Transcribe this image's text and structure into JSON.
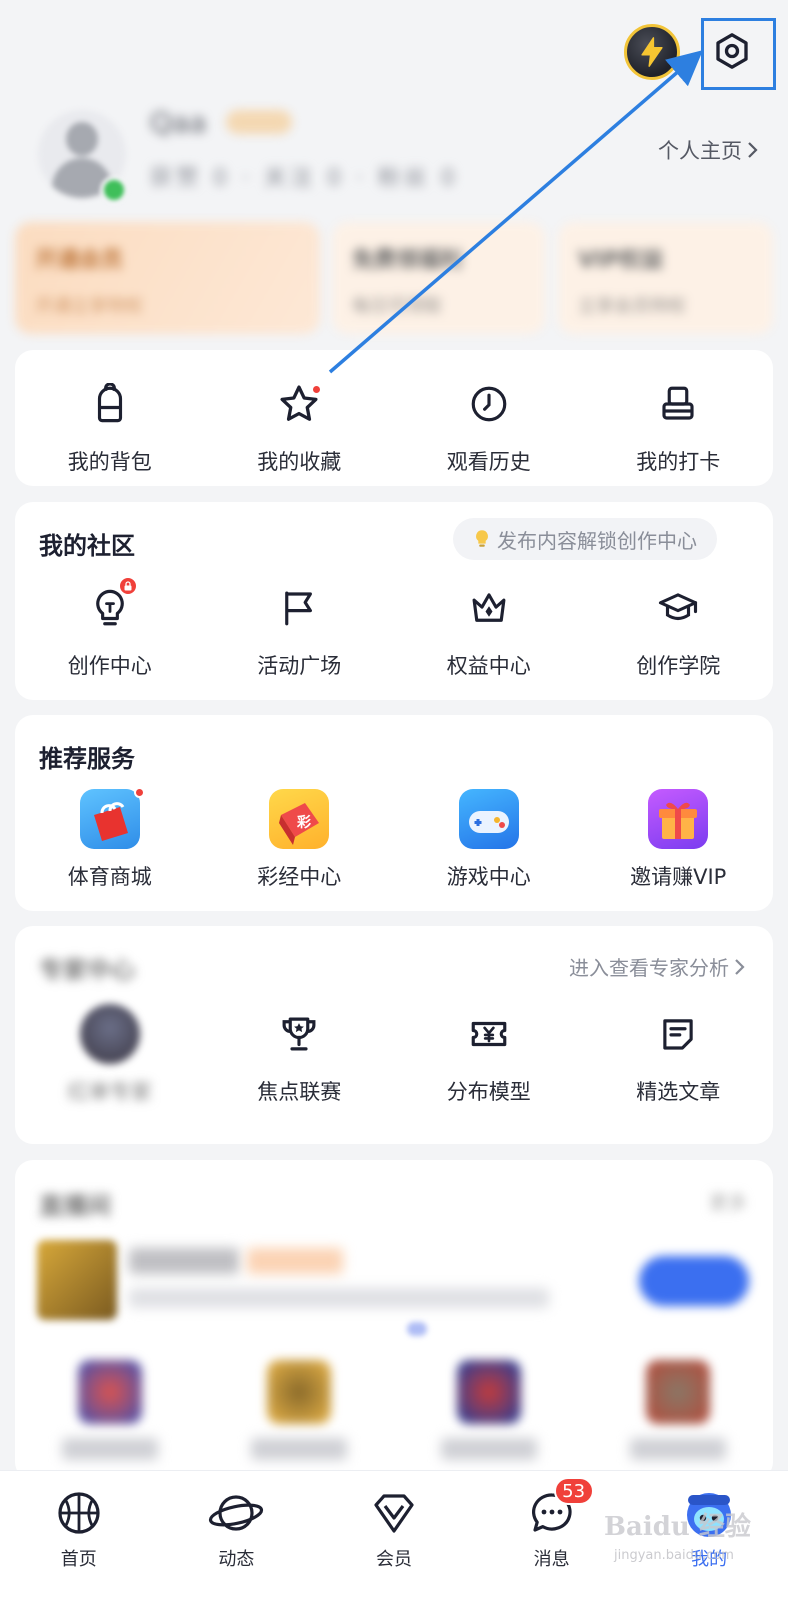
{
  "header": {
    "profile_link": "个人主页",
    "user_name_blurred": "Qaa",
    "user_stats_blurred": "获赞 0 · 关注 0 · 粉丝 0"
  },
  "promos": [
    {
      "title": "开通会员",
      "sub": "开通立享特权"
    },
    {
      "title": "免费领福利",
      "sub": "每日可领取"
    },
    {
      "title": "VIP权益",
      "sub": "立享会员特权"
    }
  ],
  "quick": {
    "items": [
      {
        "label": "我的背包",
        "icon": "backpack-icon"
      },
      {
        "label": "我的收藏",
        "icon": "star-icon"
      },
      {
        "label": "观看历史",
        "icon": "clock-icon"
      },
      {
        "label": "我的打卡",
        "icon": "checkin-icon"
      }
    ]
  },
  "community": {
    "title": "我的社区",
    "hint": "发布内容解锁创作中心",
    "items": [
      {
        "label": "创作中心",
        "icon": "lightbulb-icon"
      },
      {
        "label": "活动广场",
        "icon": "flag-icon"
      },
      {
        "label": "权益中心",
        "icon": "crown-icon"
      },
      {
        "label": "创作学院",
        "icon": "graduation-cap-icon"
      }
    ]
  },
  "services": {
    "title": "推荐服务",
    "items": [
      {
        "label": "体育商城",
        "icon": "shopping-bag-icon"
      },
      {
        "label": "彩经中心",
        "icon": "dice-icon"
      },
      {
        "label": "游戏中心",
        "icon": "gamepad-icon"
      },
      {
        "label": "邀请赚VIP",
        "icon": "gift-icon"
      }
    ]
  },
  "expert": {
    "title_blurred": "专家中心",
    "link": "进入查看专家分析",
    "items": [
      {
        "label": "红单专家",
        "icon": "expert-avatar"
      },
      {
        "label": "焦点联赛",
        "icon": "trophy-icon"
      },
      {
        "label": "分布模型",
        "icon": "ticket-icon"
      },
      {
        "label": "精选文章",
        "icon": "article-icon"
      }
    ]
  },
  "live": {
    "title_blurred": "直播间",
    "more_blurred": "更多"
  },
  "tabbar": {
    "items": [
      {
        "label": "首页",
        "icon": "basketball-icon"
      },
      {
        "label": "动态",
        "icon": "planet-icon"
      },
      {
        "label": "会员",
        "icon": "diamond-icon"
      },
      {
        "label": "消息",
        "icon": "chat-bubble-icon",
        "badge": "53"
      },
      {
        "label": "我的",
        "icon": "mascot-icon"
      }
    ],
    "active_index": 4
  },
  "watermark": {
    "brand": "Baidu 经验",
    "url": "jingyan.baidu.com"
  },
  "colors": {
    "accent": "#3c6ff0",
    "badge_red": "#f0403a",
    "annotation_blue": "#2d7fe0"
  }
}
